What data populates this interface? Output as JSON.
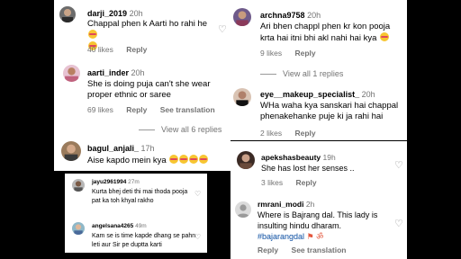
{
  "left_top": {
    "comments": [
      {
        "username": "darji_2019",
        "time": "20h",
        "text": "Chappal phen k Aarti ho rahi he",
        "likes": "40 likes",
        "reply": "Reply"
      },
      {
        "username": "aarti_inder",
        "time": "20h",
        "text_line1": "She is doing puja can't she wear",
        "text_line2": "proper ethnic or saree",
        "likes": "69 likes",
        "reply": "Reply",
        "see_translation": "See translation",
        "view_replies": "View all 6 replies"
      },
      {
        "username": "bagul_anjali_",
        "time": "17h",
        "text": "Aise kapdo mein kya"
      }
    ]
  },
  "left_bottom": {
    "comments": [
      {
        "username": "jayu2961994",
        "time": "27m",
        "text_line1": "Kurta bhej deti thi mai thoda pooja",
        "text_line2": "pat ka toh khyal rakho"
      },
      {
        "username": "angelsana4265",
        "time": "49m",
        "text_line1": "Kam se is time kapde dhang se pahn",
        "text_line2": "leti aur Sir pe duptta karti"
      }
    ]
  },
  "right_top": {
    "comments": [
      {
        "username": "archna9758",
        "time": "20h",
        "text_line1": "Ari bhen chappl phen kr kon pooja",
        "text_line2": "krta hai itni bhi akl nahi hai kya",
        "likes": "9 likes",
        "reply": "Reply",
        "view_replies": "View all 1 replies"
      },
      {
        "username": "eye__makeup_specialist_",
        "time": "20h",
        "text_line1": "WHa waha kya sanskari hai chappal",
        "text_line2": "phenakehanke puje ki ja rahi hai",
        "likes": "2 likes",
        "reply": "Reply"
      }
    ]
  },
  "right_bottom": {
    "comments": [
      {
        "username": "apekshasbeauty",
        "time": "19h",
        "text": "She has lost her senses ..",
        "likes": "3 likes",
        "reply": "Reply"
      },
      {
        "username": "rmrani_modi",
        "time": "2h",
        "text_line1": "Where is Bajrang dal. This lady is",
        "text_line2": "insulting hindu dharam.",
        "hashtag": "#bajarangdal",
        "reply": "Reply",
        "see_translation": "See translation"
      }
    ]
  },
  "colors": {
    "background": "#000000",
    "panel": "#ffffff",
    "secondary_text": "#737373",
    "hashtag": "#0b4ea2"
  },
  "icons": [
    "heart-outline-icon",
    "laughing-emoji-icon",
    "flag-icon",
    "om-icon"
  ]
}
